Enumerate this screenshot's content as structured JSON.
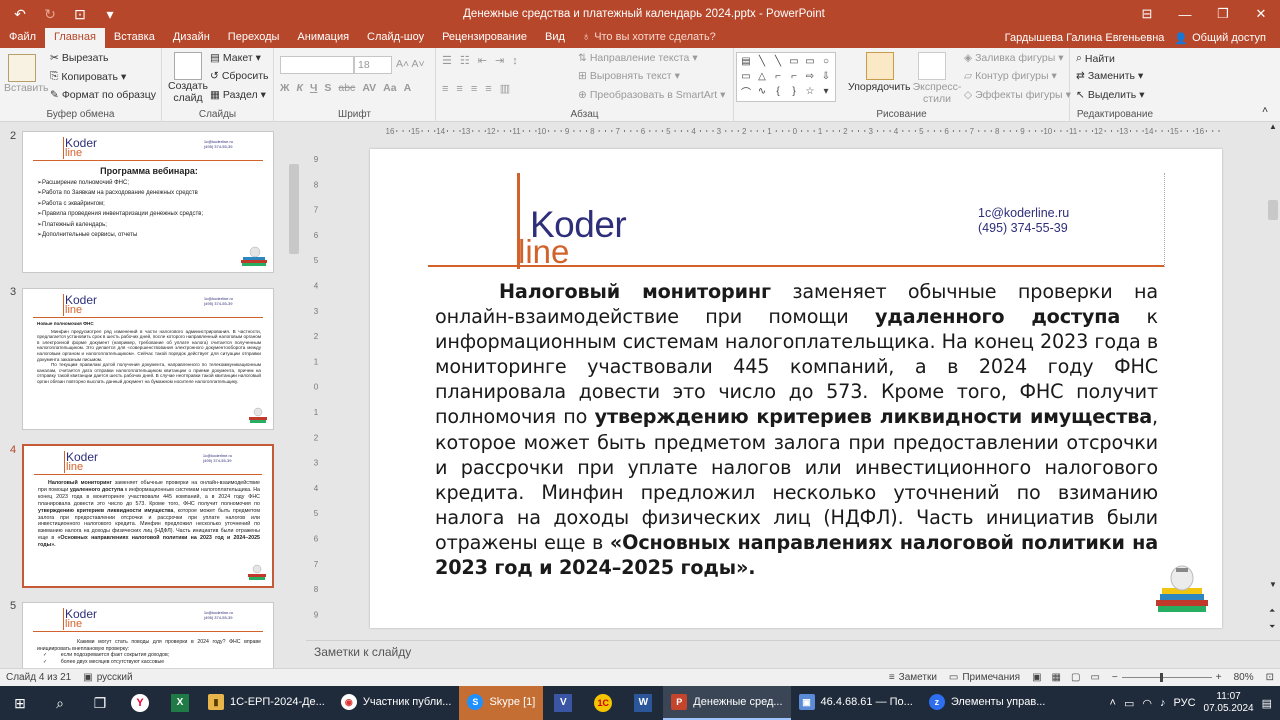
{
  "titlebar": {
    "title": "Денежные средства и платежный календарь 2024.pptx - PowerPoint",
    "qat": [
      "save-icon",
      "undo-icon",
      "redo-icon",
      "present-icon",
      "customize-icon"
    ]
  },
  "tabs": [
    "Файл",
    "Главная",
    "Вставка",
    "Дизайн",
    "Переходы",
    "Анимация",
    "Слайд-шоу",
    "Рецензирование",
    "Вид"
  ],
  "active_tab": "Главная",
  "tell_me": "Что вы хотите сделать?",
  "user": "Гардышева Галина Евгеньевна",
  "share": "Общий доступ",
  "ribbon": {
    "clipboard": {
      "paste": "Вставить",
      "cut": "Вырезать",
      "copy": "Копировать",
      "format_painter": "Формат по образцу",
      "label": "Буфер обмена"
    },
    "slides": {
      "new_slide": "Создать слайд",
      "layout": "Макет",
      "reset": "Сбросить",
      "section": "Раздел",
      "label": "Слайды"
    },
    "font": {
      "size": "18",
      "label": "Шрифт",
      "buttons": [
        "Ж",
        "К",
        "Ч",
        "S",
        "abc",
        "AV",
        "Aa",
        "A"
      ]
    },
    "paragraph": {
      "text_direction": "Направление текста",
      "align_text": "Выровнять текст",
      "smartart": "Преобразовать в SmartArt",
      "label": "Абзац"
    },
    "drawing": {
      "arrange": "Упорядочить",
      "quick_styles": "Экспресс-стили",
      "fill": "Заливка фигуры",
      "outline": "Контур фигуры",
      "effects": "Эффекты фигуры",
      "label": "Рисование"
    },
    "editing": {
      "find": "Найти",
      "replace": "Заменить",
      "select": "Выделить",
      "label": "Редактирование"
    }
  },
  "thumbnails": [
    {
      "num": "2",
      "title": "Программа вебинара:",
      "items": [
        "Расширение полномочий ФНС;",
        "Работа по Заявкам на расходование денежных средств",
        "Работа с эквайрингом;",
        "Правила проведения инвентаризации денежных средств;",
        "Платежный календарь;",
        "Дополнительные сервисы, отчеты"
      ]
    },
    {
      "num": "3",
      "heading": "Новые полномочия ФНС",
      "p1": "Минфин предусмотрел ряд изменений в части налогового администрирования. В частности, предлагается установить срок в шесть рабочих дней, после которого направленный налоговым органом в электронной форме документ (например, требование об уплате налога) считается полученным налогоплательщиком. Это делается для «совершенствования электронного документооборота между налоговым органом и налогоплательщиком». Сейчас такой порядок действует для ситуации отправки документа заказным письмом.",
      "p2": "По текущим правилам датой получения документа, направленного по телекоммуникационным каналам, считается дата отправки налогоплательщиком квитанции о приеме документа, причем на отправку такой квитанции дается шесть рабочих дней. В случае неотправки такой квитанции налоговый орган обязан повторно выслать данный документ на бумажном носителе налогоплательщику."
    },
    {
      "num": "4"
    },
    {
      "num": "5",
      "p1": "Какими могут стать поводы для проверки в 2024 году? ФНС вправе инициировать внеплановую проверку:",
      "items": [
        "если подозревается факт сокрытия доходов;",
        "более двух месяцев отсутствуют кассовые"
      ]
    }
  ],
  "slide": {
    "logo_top": "Koder",
    "logo_bottom": "line",
    "email": "1c@koderline.ru",
    "phone": "(495) 374-55-39",
    "t1": "Налоговый мониторинг",
    "t2": " заменяет обычные проверки на онлайн-взаимодействие при помощи ",
    "t3": "удаленного доступа",
    "t4": " к информационным системам налогоплательщика. На конец 2023 года в мониторинге участвовали 445 компаний, а в 2024 году ФНС планировала довести это число до 573. Кроме того, ФНС получит полномочия по ",
    "t5": "утверждению критериев ликвидности имущества",
    "t6": ", которое может быть предметом залога при предоставлении отсрочки и рассрочки при уплате налогов или инвестиционного налогового кредита. Минфин предложил несколько уточнений по взиманию налога на доходы физических лиц (НДФЛ). Часть инициатив были отражены еще в ",
    "t7": "«Основных направлениях налоговой политики на 2023 год и 2024–2025 годы»."
  },
  "notes_placeholder": "Заметки к слайду",
  "statusbar": {
    "slide": "Слайд 4 из 21",
    "lang": "русский",
    "notes": "Заметки",
    "comments": "Примечания",
    "zoom": "80%"
  },
  "taskbar": {
    "apps": [
      {
        "label": "1С-ЕРП-2024-Де...",
        "color": "#e8b54a",
        "icon": "▮"
      },
      {
        "label": "Участник публи...",
        "color": "#ffffff",
        "icon": "◉"
      },
      {
        "label": "Skype [1]",
        "color": "#1e90ff",
        "icon": "S"
      },
      {
        "label": "Денежные сред...",
        "color": "#c4452c",
        "icon": "P"
      },
      {
        "label": "46.4.68.61 — По...",
        "color": "#5b8bd6",
        "icon": "▣"
      },
      {
        "label": "Элементы управ...",
        "color": "#2d6ff0",
        "icon": "z"
      }
    ],
    "lang": "РУС",
    "time": "11:07",
    "date": "07.05.2024"
  }
}
